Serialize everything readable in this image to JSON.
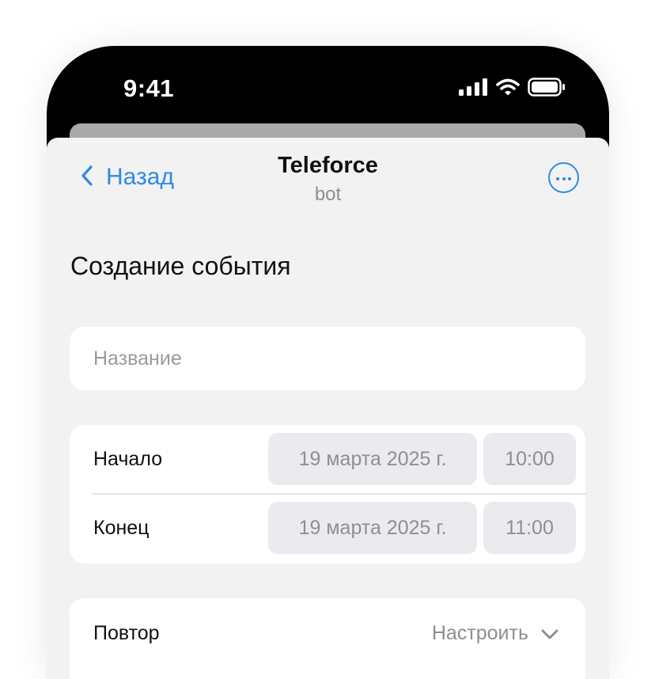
{
  "status_bar": {
    "time": "9:41",
    "icons": [
      "signal-icon",
      "wifi-icon",
      "battery-icon"
    ]
  },
  "nav": {
    "back_label": "Назад",
    "title": "Teleforce",
    "subtitle": "bot",
    "more_icon": "more-circle-icon"
  },
  "page": {
    "title": "Создание события"
  },
  "form": {
    "name": {
      "placeholder": "Название",
      "value": ""
    },
    "start": {
      "label": "Начало",
      "date": "19 марта 2025 г.",
      "time": "10:00"
    },
    "end": {
      "label": "Конец",
      "date": "19 марта 2025 г.",
      "time": "11:00"
    },
    "repeat": {
      "label": "Повтор",
      "value": "Настроить",
      "icon": "chevron-down-icon"
    }
  },
  "colors": {
    "accent": "#2e8ae3",
    "sheet_background": "#f2f2f3",
    "pill_background": "#ebebef",
    "secondary_text": "#8e8e93"
  }
}
